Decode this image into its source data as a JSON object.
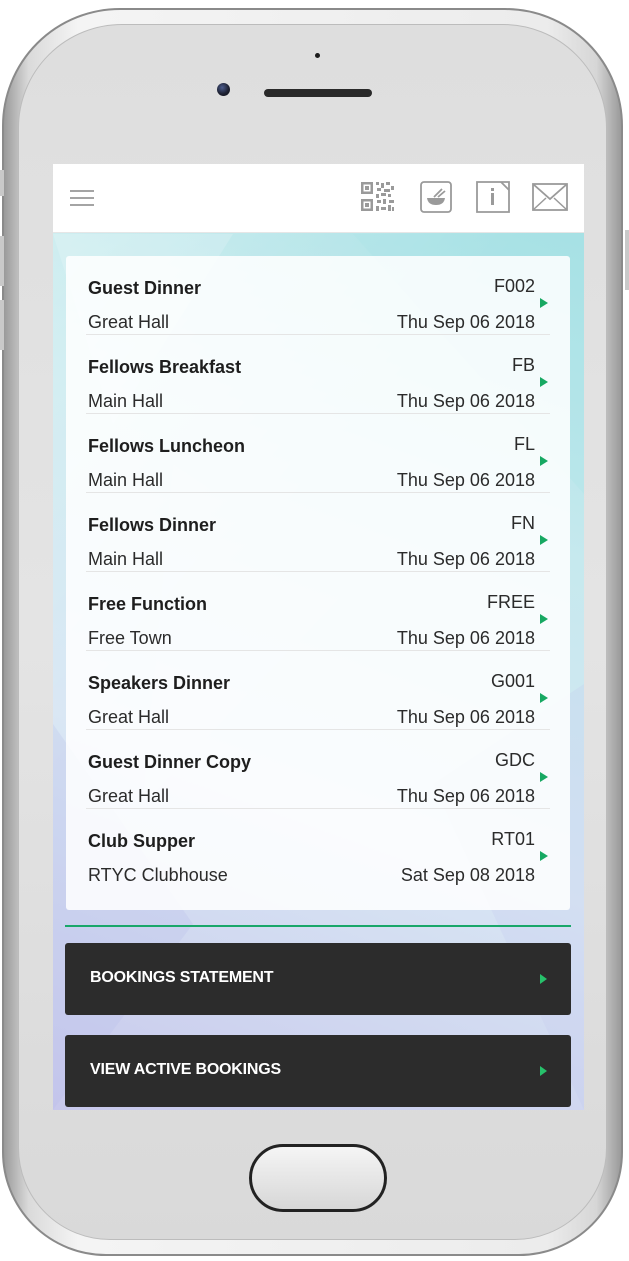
{
  "header": {
    "menu_icon": "hamburger-menu-icon",
    "icons": [
      "qr-code-icon",
      "food-bowl-icon",
      "info-icon",
      "mail-icon"
    ]
  },
  "events": [
    {
      "name": "Guest Dinner",
      "venue": "Great Hall",
      "code": "F002",
      "date": "Thu Sep 06 2018"
    },
    {
      "name": "Fellows Breakfast",
      "venue": "Main Hall",
      "code": "FB",
      "date": "Thu Sep 06 2018"
    },
    {
      "name": "Fellows Luncheon",
      "venue": "Main Hall",
      "code": "FL",
      "date": "Thu Sep 06 2018"
    },
    {
      "name": "Fellows Dinner",
      "venue": "Main Hall",
      "code": "FN",
      "date": "Thu Sep 06 2018"
    },
    {
      "name": "Free Function",
      "venue": "Free Town",
      "code": "FREE",
      "date": "Thu Sep 06 2018"
    },
    {
      "name": "Speakers Dinner",
      "venue": "Great Hall",
      "code": "G001",
      "date": "Thu Sep 06 2018"
    },
    {
      "name": "Guest Dinner Copy",
      "venue": "Great Hall",
      "code": "GDC",
      "date": "Thu Sep 06 2018"
    },
    {
      "name": "Club Supper",
      "venue": "RTYC Clubhouse",
      "code": "RT01",
      "date": "Sat Sep 08 2018"
    }
  ],
  "actions": {
    "bookings_statement": "BOOKINGS STATEMENT",
    "view_active_bookings": "VIEW ACTIVE BOOKINGS"
  },
  "colors": {
    "accent_green": "#17a862",
    "button_dark": "#2c2c2c",
    "screen_bg": "#bfe7e9"
  }
}
